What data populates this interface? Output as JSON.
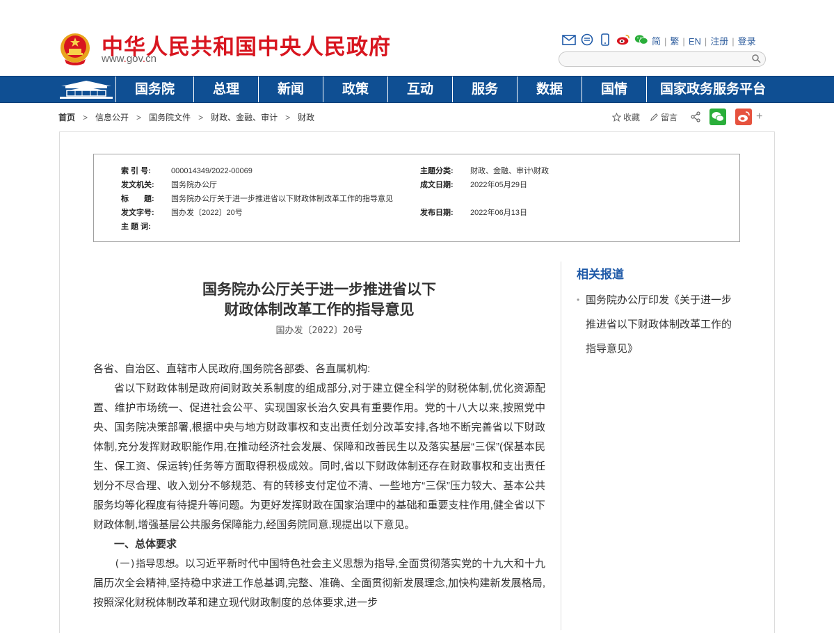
{
  "header": {
    "site_title": "中华人民共和国中央人民政府",
    "site_url_pre": "www",
    "site_url_dot1": ".",
    "site_url_mid": "gov",
    "site_url_dot2": ".",
    "site_url_end": "cn",
    "icons": [
      "mail-icon",
      "rss-icon",
      "mobile-icon",
      "weibo-icon",
      "wechat-icon"
    ],
    "links": [
      "简",
      "繁",
      "EN",
      "注册",
      "登录"
    ],
    "search_placeholder": ""
  },
  "nav": {
    "items": [
      "国务院",
      "总理",
      "新闻",
      "政策",
      "互动",
      "服务",
      "数据",
      "国情",
      "国家政务服务平台"
    ]
  },
  "breadcrumb": [
    "首页",
    "信息公开",
    "国务院文件",
    "财政、金融、审计",
    "财政"
  ],
  "share": {
    "favorite": "收藏",
    "comment": "留言",
    "plus": "+"
  },
  "meta": {
    "index_label": "索 引 号:",
    "index_value": "000014349/2022-00069",
    "subject_label": "主题分类:",
    "subject_value": "财政、金融、审计\\财政",
    "issuer_label": "发文机关:",
    "issuer_value": "国务院办公厅",
    "written_label": "成文日期:",
    "written_value": "2022年05月29日",
    "title_label": "标　　题:",
    "title_value": "国务院办公厅关于进一步推进省以下财政体制改革工作的指导意见",
    "docno_label": "发文字号:",
    "docno_value": "国办发〔2022〕20号",
    "published_label": "发布日期:",
    "published_value": "2022年06月13日",
    "keywords_label": "主 题 词:",
    "keywords_value": ""
  },
  "article": {
    "title_line1": "国务院办公厅关于进一步推进省以下",
    "title_line2": "财政体制改革工作的指导意见",
    "doc_no": "国办发〔2022〕20号",
    "salutation": "各省、自治区、直辖市人民政府,国务院各部委、各直属机构:",
    "para1": "省以下财政体制是政府间财政关系制度的组成部分,对于建立健全科学的财税体制,优化资源配置、维护市场统一、促进社会公平、实现国家长治久安具有重要作用。党的十八大以来,按照党中央、国务院决策部署,根据中央与地方财政事权和支出责任划分改革安排,各地不断完善省以下财政体制,充分发挥财政职能作用,在推动经济社会发展、保障和改善民生以及落实基层“三保”(保基本民生、保工资、保运转)任务等方面取得积极成效。同时,省以下财政体制还存在财政事权和支出责任划分不尽合理、收入划分不够规范、有的转移支付定位不清、一些地方“三保”压力较大、基本公共服务均等化程度有待提升等问题。为更好发挥财政在国家治理中的基础和重要支柱作用,健全省以下财政体制,增强基层公共服务保障能力,经国务院同意,现提出以下意见。",
    "heading1": "一、总体要求",
    "sub1_label": "(一)指导思想。",
    "sub1_text": "以习近平新时代中国特色社会主义思想为指导,全面贯彻落实党的十九大和十九届历次全会精神,坚持稳中求进工作总基调,完整、准确、全面贯彻新发展理念,加快构建新发展格局,按照深化财税体制改革和建立现代财政制度的总体要求,进一步"
  },
  "sidebar": {
    "title": "相关报道",
    "item": "国务院办公厅印发《关于进一步推进省以下财政体制改革工作的指导意见》"
  }
}
